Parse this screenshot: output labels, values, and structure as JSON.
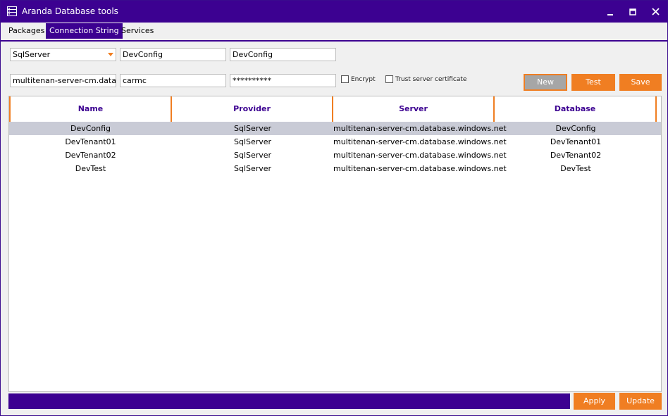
{
  "window": {
    "title": "Aranda Database tools"
  },
  "tabs": [
    {
      "label": "Packages",
      "active": false
    },
    {
      "label": "Connection String",
      "active": true
    },
    {
      "label": "Services",
      "active": false
    }
  ],
  "form": {
    "provider_select": "SqlServer",
    "name_field": "DevConfig",
    "database_field": "DevConfig",
    "server_field": "multitenan-server-cm.databa",
    "user_field": "carmc",
    "password_field": "**********",
    "encrypt_label": "Encrypt",
    "encrypt_checked": false,
    "trust_label": "Trust server certificate",
    "trust_checked": false
  },
  "buttons": {
    "new": "New",
    "test": "Test",
    "save": "Save",
    "apply": "Apply",
    "update": "Update"
  },
  "grid": {
    "columns": [
      "Name",
      "Provider",
      "Server",
      "Database"
    ],
    "rows": [
      {
        "name": "DevConfig",
        "provider": "SqlServer",
        "server": "multitenan-server-cm.database.windows.net",
        "database": "DevConfig",
        "selected": true
      },
      {
        "name": "DevTenant01",
        "provider": "SqlServer",
        "server": "multitenan-server-cm.database.windows.net",
        "database": "DevTenant01",
        "selected": false
      },
      {
        "name": "DevTenant02",
        "provider": "SqlServer",
        "server": "multitenan-server-cm.database.windows.net",
        "database": "DevTenant02",
        "selected": false
      },
      {
        "name": "DevTest",
        "provider": "SqlServer",
        "server": "multitenan-server-cm.database.windows.net",
        "database": "DevTest",
        "selected": false
      }
    ]
  },
  "colors": {
    "brand": "#3c0191",
    "accent": "#f07e22",
    "selection": "#c9cbd6"
  },
  "icons": {
    "app": "database-tools-icon",
    "minimize": "minimize-icon",
    "maximize": "maximize-icon",
    "close": "close-icon",
    "select_caret": "chevron-down-icon"
  }
}
